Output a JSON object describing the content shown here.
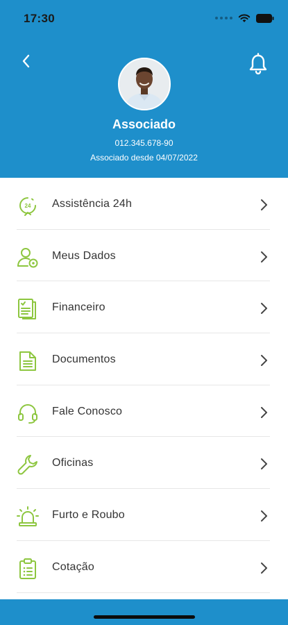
{
  "status_bar": {
    "time": "17:30"
  },
  "header": {
    "background": "#1E8FCB",
    "name": "Associado",
    "member_id": "012.345.678-90",
    "member_since": "Associado desde 04/07/2022"
  },
  "menu": {
    "accent": "#8DC63F",
    "items": [
      {
        "label": "Assistência 24h",
        "icon": "clock-24h-icon"
      },
      {
        "label": "Meus Dados",
        "icon": "user-settings-icon"
      },
      {
        "label": "Financeiro",
        "icon": "financial-document-icon"
      },
      {
        "label": "Documentos",
        "icon": "document-icon"
      },
      {
        "label": "Fale Conosco",
        "icon": "headset-icon"
      },
      {
        "label": "Oficinas",
        "icon": "wrench-icon"
      },
      {
        "label": "Furto e Roubo",
        "icon": "siren-icon"
      },
      {
        "label": "Cotação",
        "icon": "clipboard-list-icon"
      }
    ]
  }
}
